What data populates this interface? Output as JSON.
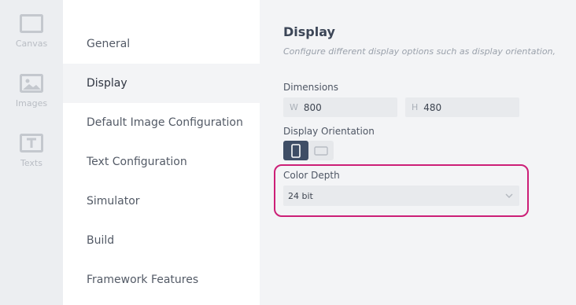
{
  "rail": {
    "items": [
      {
        "label": "Canvas",
        "icon": "canvas-icon"
      },
      {
        "label": "Images",
        "icon": "image-icon"
      },
      {
        "label": "Texts",
        "icon": "text-icon"
      }
    ]
  },
  "menu": {
    "items": [
      {
        "label": "General"
      },
      {
        "label": "Display",
        "active": true
      },
      {
        "label": "Default Image Configuration"
      },
      {
        "label": "Text Configuration"
      },
      {
        "label": "Simulator"
      },
      {
        "label": "Build"
      },
      {
        "label": "Framework Features"
      }
    ]
  },
  "display": {
    "title": "Display",
    "subtitle": "Configure different display options such as display orientation,",
    "dimensions": {
      "label": "Dimensions",
      "width_prefix": "W",
      "width_value": "800",
      "height_prefix": "H",
      "height_value": "480"
    },
    "orientation": {
      "label": "Display Orientation",
      "selected": "portrait"
    },
    "color_depth": {
      "label": "Color Depth",
      "value": "24 bit"
    }
  },
  "colors": {
    "highlight": "#cc1f77",
    "selected_button": "#3f4e66"
  }
}
